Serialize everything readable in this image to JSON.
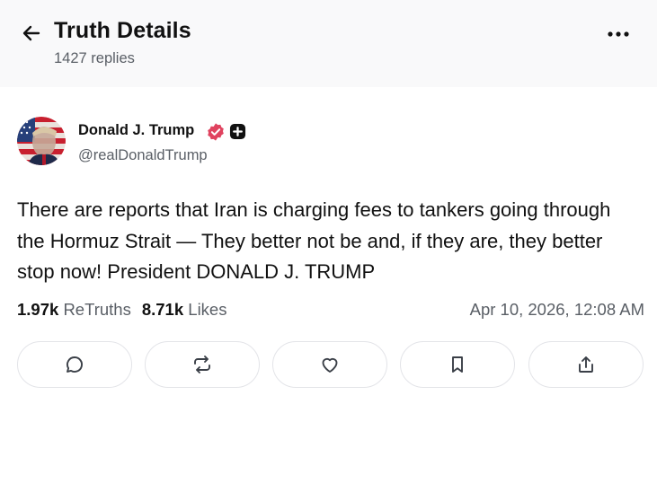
{
  "header": {
    "title": "Truth Details",
    "replies": "1427 replies",
    "back_icon": "arrow-left-icon",
    "more_icon": "more-horizontal-icon"
  },
  "author": {
    "name": "Donald J. Trump",
    "handle": "@realDonaldTrump",
    "verified": true,
    "verified_color": "#e0435f"
  },
  "post": {
    "text": "There are reports that Iran is charging fees to tankers going through the Hormuz Strait — They better not be and, if they are, they better stop now! President DONALD J. TRUMP",
    "retruths_count": "1.97k",
    "retruths_label": "ReTruths",
    "likes_count": "8.71k",
    "likes_label": "Likes",
    "timestamp": "Apr 10, 2026, 12:08 AM"
  },
  "actions": [
    {
      "name": "reply",
      "icon": "comment-icon"
    },
    {
      "name": "retruth",
      "icon": "repost-icon"
    },
    {
      "name": "like",
      "icon": "heart-icon"
    },
    {
      "name": "bookmark",
      "icon": "bookmark-icon"
    },
    {
      "name": "share",
      "icon": "share-icon"
    }
  ],
  "colors": {
    "header_bg": "#f9f9fa",
    "text": "#111111",
    "muted": "#5a5f66",
    "border": "#e3e4e8"
  }
}
